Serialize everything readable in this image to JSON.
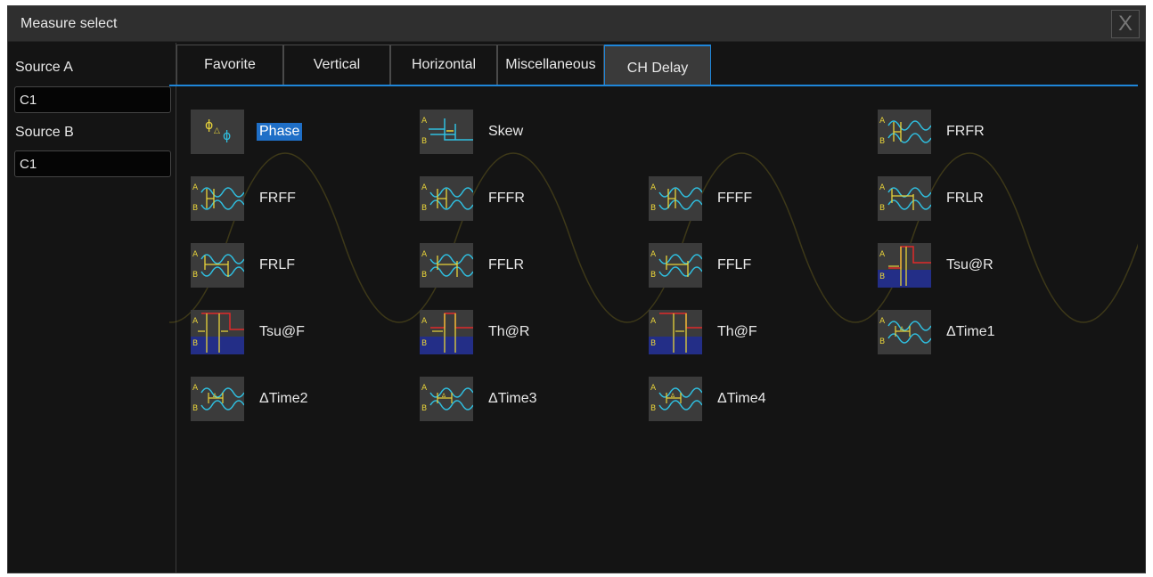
{
  "dialog": {
    "title": "Measure select",
    "close_label": "X"
  },
  "sidebar": {
    "source_a_label": "Source A",
    "source_a_value": "C1",
    "source_b_label": "Source B",
    "source_b_value": "C1"
  },
  "tabs": [
    {
      "label": "Favorite",
      "active": false
    },
    {
      "label": "Vertical",
      "active": false
    },
    {
      "label": "Horizontal",
      "active": false
    },
    {
      "label": "Miscellaneous",
      "active": false
    },
    {
      "label": "CH Delay",
      "active": true
    }
  ],
  "measurements": [
    {
      "label": "Phase",
      "icon": "phase-icon",
      "selected": true
    },
    {
      "label": "Skew",
      "icon": "skew-icon"
    },
    {
      "label": "FRFR",
      "icon": "frfr-icon"
    },
    {
      "label": "FRFF",
      "icon": "frff-icon"
    },
    {
      "label": "FFFR",
      "icon": "fffr-icon"
    },
    {
      "label": "FFFF",
      "icon": "ffff-icon"
    },
    {
      "label": "FRLR",
      "icon": "frlr-icon"
    },
    {
      "label": "FRLF",
      "icon": "frlf-icon"
    },
    {
      "label": "FFLR",
      "icon": "fflr-icon"
    },
    {
      "label": "FFLF",
      "icon": "fflf-icon"
    },
    {
      "label": "Tsu@R",
      "icon": "tsu-r-icon"
    },
    {
      "label": "Tsu@F",
      "icon": "tsu-f-icon"
    },
    {
      "label": "Th@R",
      "icon": "th-r-icon"
    },
    {
      "label": "Th@F",
      "icon": "th-f-icon"
    },
    {
      "label": "ΔTime1",
      "icon": "delta-time1-icon"
    },
    {
      "label": "ΔTime2",
      "icon": "delta-time2-icon"
    },
    {
      "label": "ΔTime3",
      "icon": "delta-time3-icon"
    },
    {
      "label": "ΔTime4",
      "icon": "delta-time4-icon"
    }
  ],
  "colors": {
    "accent": "#1f86d9",
    "selected_bg": "#1f6fc7",
    "wave_yellow": "#e8d33a",
    "wave_cyan": "#2fbfe0",
    "marker_red": "#e02a2a",
    "low_blue": "#1a2aa8"
  }
}
